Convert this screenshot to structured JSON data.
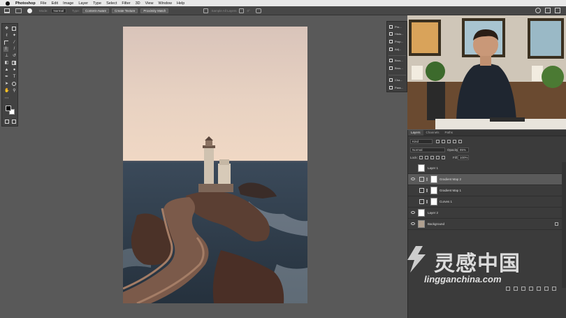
{
  "menubar": {
    "app": "Photoshop",
    "items": [
      "File",
      "Edit",
      "Image",
      "Layer",
      "Type",
      "Select",
      "Filter",
      "3D",
      "View",
      "Window",
      "Help"
    ]
  },
  "options": {
    "mode_label": "Mode:",
    "mode_value": "Normal",
    "type_label": "Type:",
    "type_buttons": [
      "Content-Aware",
      "Create Texture",
      "Proximity Match"
    ],
    "sample_all": "Sample All Layers",
    "angle": "0°"
  },
  "panelstrip": {
    "items": [
      "Pro...",
      "Histo...",
      "Prop...",
      "Adj...",
      "Brus...",
      "Brus...",
      "Cha...",
      "Para..."
    ]
  },
  "layers_panel": {
    "tabs": [
      "Layers",
      "Channels",
      "Paths"
    ],
    "filter_kind": "Kind",
    "blend_mode": "Normal",
    "opacity_label": "Opacity:",
    "opacity_value": "85%",
    "lock_label": "Lock:",
    "fill_label": "Fill:",
    "fill_value": "100%",
    "layers": [
      {
        "name": "Layer 1",
        "visible": false,
        "selected": false,
        "type": "pixel"
      },
      {
        "name": "Gradient Map 2",
        "visible": true,
        "selected": true,
        "type": "adjustment"
      },
      {
        "name": "Gradient Map 1",
        "visible": false,
        "selected": false,
        "type": "adjustment"
      },
      {
        "name": "Curves 1",
        "visible": false,
        "selected": false,
        "type": "adjustment"
      },
      {
        "name": "Layer 2",
        "visible": true,
        "selected": false,
        "type": "pixel"
      },
      {
        "name": "Background",
        "visible": true,
        "selected": false,
        "type": "background"
      }
    ]
  },
  "watermark": {
    "title": "灵感中国",
    "url": "lingganchina.com"
  },
  "colors": {
    "menubar_bg": "#e8e8e8",
    "workspace": "#595959",
    "panel": "#3b3b3b",
    "selected_layer": "#5a5a5a",
    "watermark_logo": "#c0392b"
  }
}
